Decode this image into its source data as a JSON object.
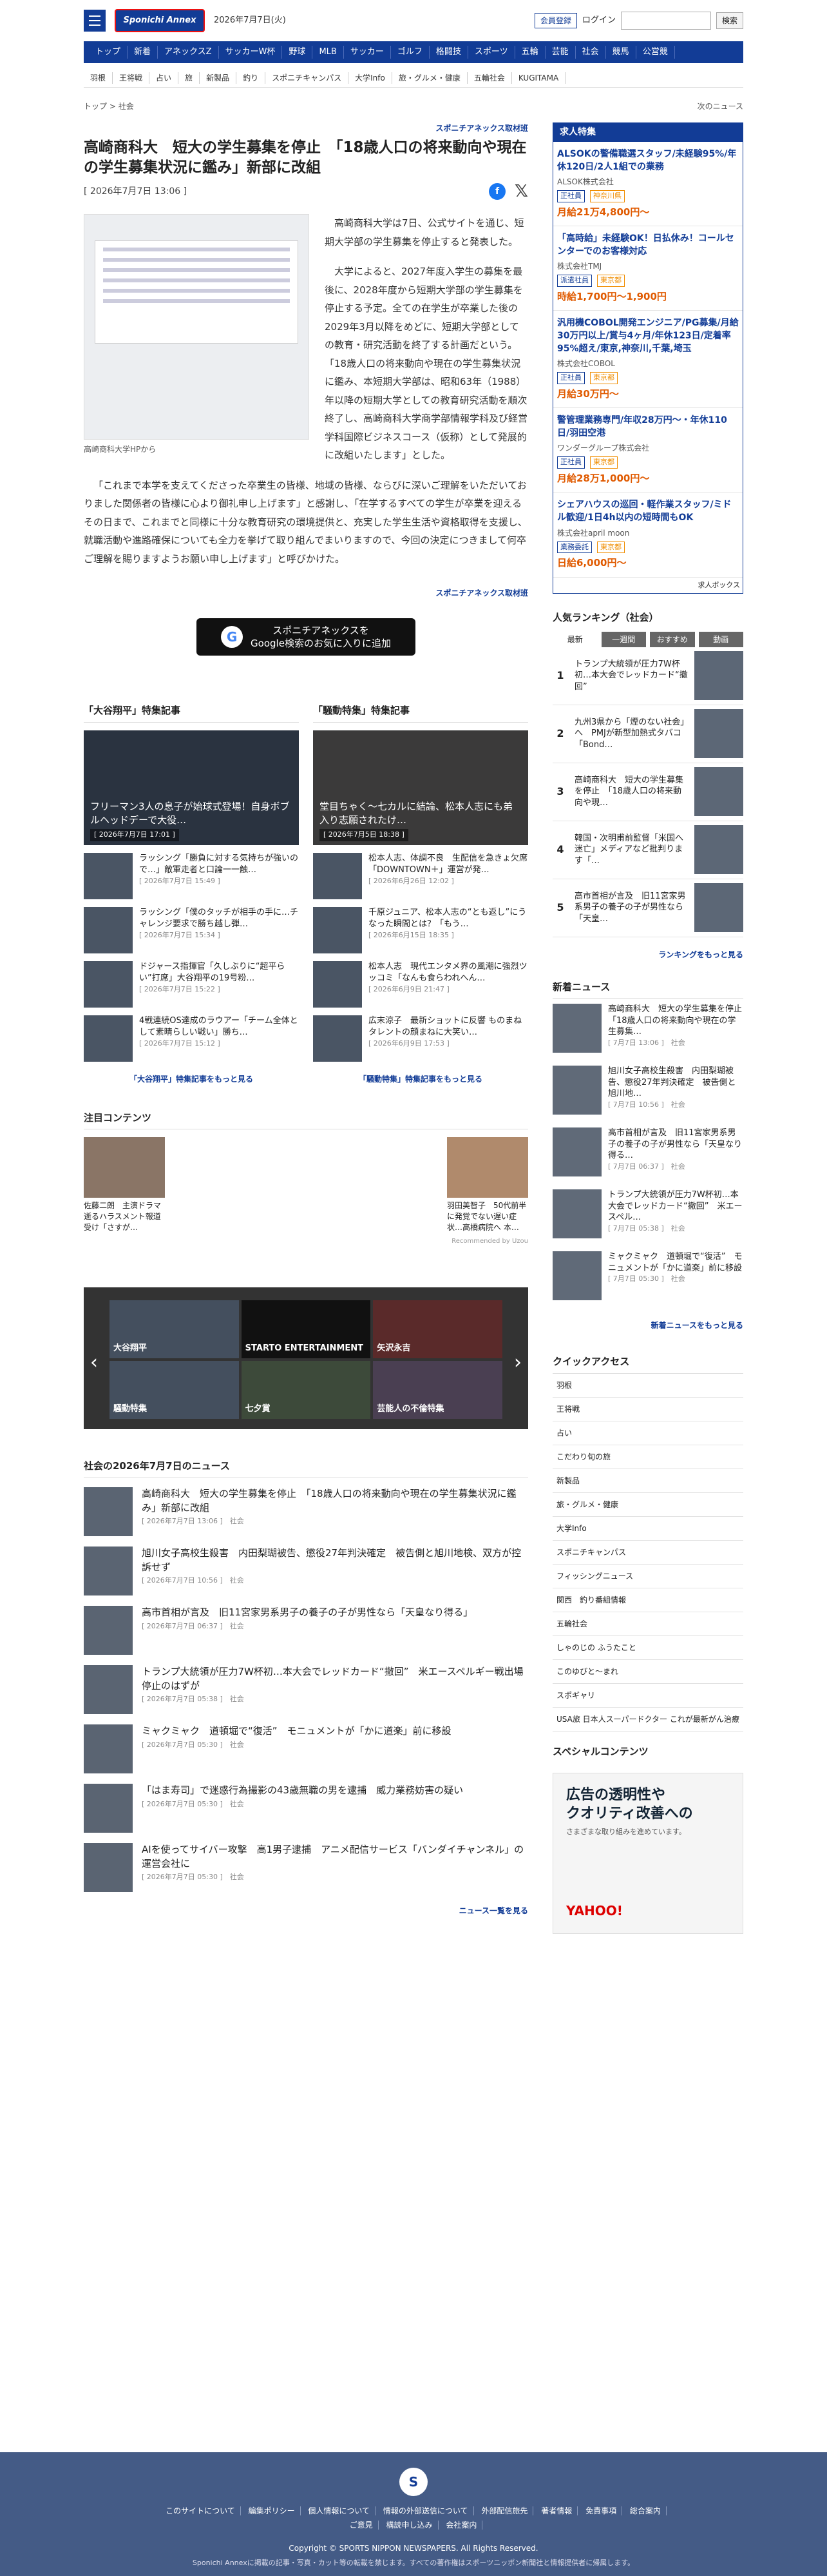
{
  "header": {
    "site_logo": "Sponichi Annex",
    "date": "2026年7月7日(火)",
    "member_register": "会員登録",
    "login": "ログイン",
    "search_button": "検索"
  },
  "nav": [
    "トップ",
    "新着",
    "アネックスZ",
    "サッカーW杯",
    "野球",
    "MLB",
    "サッカー",
    "ゴルフ",
    "格闘技",
    "スポーツ",
    "五輪",
    "芸能",
    "社会",
    "競馬",
    "公営競"
  ],
  "subnav": [
    "羽根",
    "王将戦",
    "占い",
    "旅",
    "新製品",
    "釣り",
    "スポニチキャンパス",
    "大学Info",
    "旅・グルメ・健康",
    "五輪社会",
    "KUGITAMA"
  ],
  "breadcrumb": {
    "top": "トップ",
    "sep": ">",
    "current": "社会",
    "next": "次のニュース"
  },
  "article": {
    "sponsor": "スポニチアネックス取材班",
    "title": "高崎商科大　短大の学生募集を停止　「18歳人口の将来動向や現在の学生募集状況に鑑み」新部に改組",
    "date": "[ 2026年7月7日 13:06 ]",
    "caption": "高崎商科大学HPから",
    "p1": "高崎商科大学は7日、公式サイトを通じ、短期大学部の学生募集を停止すると発表した。",
    "p2": "大学によると、2027年度入学生の募集を最後に、2028年度から短期大学部の学生募集を停止する予定。全ての在学生が卒業した後の2029年3月以降をめどに、短期大学部としての教育・研究活動を終了する計画だという。「18歳人口の将来動向や現在の学生募集状況に鑑み、本短期大学部は、昭和63年（1988）年以降の短期大学としての教育研究活動を順次終了し、高崎商科大学商学部情報学科及び経営学科国際ビジネスコース（仮称）として発展的に改組いたします」とした。",
    "p3": "「これまで本学を支えてくださった卒業生の皆様、地域の皆様、ならびに深いご理解をいただいておりました関係者の皆様に心より御礼申し上げます」と感謝し、「在学するすべての学生が卒業を迎えるその日まで、これまでと同様に十分な教育研究の環境提供と、充実した学生生活や資格取得を支援し、就職活動や進路確保についても全力を挙げて取り組んでまいりますので、今回の決定につきまして何卒ご理解を賜りますようお願い申し上げます」と呼びかけた。",
    "sponsor_bottom": "スポニチアネックス取材班",
    "google_line1": "スポニチアネックスを",
    "google_line2": "Google検索のお気に入りに追加"
  },
  "features": {
    "left_title": "「大谷翔平」特集記事",
    "left_hero": "フリーマン3人の息子が始球式登場！自身ボブルヘッドデーで大役…",
    "left_hero_date": "[ 2026年7月7日 17:01 ]",
    "left_items": [
      {
        "t": "ラッシング「勝負に対する気持ちが強いので…」敵軍走者と口論一一触…",
        "d": "[ 2026年7月7日 15:49 ]"
      },
      {
        "t": "ラッシング「僕のタッチが相手の手に…チャレンジ要求で勝ち越し弾…",
        "d": "[ 2026年7月7日 15:34 ]"
      },
      {
        "t": "ドジャース指揮官「久しぶりに“超平らい”打席」大谷翔平の19号粉…",
        "d": "[ 2026年7月7日 15:22 ]"
      },
      {
        "t": "4戦連続OS達成のラウアー「チーム全体として素晴らしい戦い」勝ち…",
        "d": "[ 2026年7月7日 15:12 ]"
      }
    ],
    "left_more": "「大谷翔平」特集記事をもっと見る",
    "right_title": "「騒動特集」特集記事",
    "right_hero": "堂目ちゃく～七カルに結論、松本人志にも弟入り志願されたけ…",
    "right_hero_date": "[ 2026年7月5日 18:38 ]",
    "right_items": [
      {
        "t": "松本人志、体調不良　生配信を急きょ欠席「DOWNTOWN＋」運営が発…",
        "d": "[ 2026年6月26日 12:02 ]"
      },
      {
        "t": "千原ジュニア、松本人志の“とも返し”にうなった瞬間とは？「もう…",
        "d": "[ 2026年6月15日 18:35 ]"
      },
      {
        "t": "松本人志　現代エンタメ界の風潮に強烈ツッコミ「なんも食らわれへん…",
        "d": "[ 2026年6月9日 21:47 ]"
      },
      {
        "t": "広末涼子　最新ショットに反響 ものまねタレントの顔まねに大笑い…",
        "d": "[ 2026年6月9日 17:53 ]"
      }
    ],
    "right_more": "「騒動特集」特集記事をもっと見る"
  },
  "attention": {
    "title": "注目コンテンツ",
    "left_text": "佐藤二朗　主演ドラマ逝るハラスメント報道受け「さすが…",
    "right_text": "羽田美智子　50代前半に発覚でない遅い症状…高橋病院へ 本…",
    "recommend": "Recommended by Uzou"
  },
  "banner_tiles": [
    "大谷翔平",
    "STARTO ENTERTAINMENT",
    "矢沢永吉",
    "騒動特集",
    "七夕賞",
    "芸能人の不倫特集"
  ],
  "social_news": {
    "title": "社会の2026年7月7日のニュース",
    "items": [
      {
        "t": "高崎商科大　短大の学生募集を停止　「18歳人口の将来動向や現在の学生募集状況に鑑み」新部に改組",
        "d": "[ 2026年7月7日 13:06 ]　社会"
      },
      {
        "t": "旭川女子高校生殺害　内田梨瑚被告、懲役27年判決確定　被告側と旭川地検、双方が控訴せず",
        "d": "[ 2026年7月7日 10:56 ]　社会"
      },
      {
        "t": "高市首相が言及　旧11宮家男系男子の養子の子が男性なら「天皇なり得る」",
        "d": "[ 2026年7月7日 06:37 ]　社会"
      },
      {
        "t": "トランプ大統領が圧力7W杯初…本大会でレッドカード“撤回”　米エースペルギー戦出場停止のはずが",
        "d": "[ 2026年7月7日 05:38 ]　社会"
      },
      {
        "t": "ミャクミャク　道頓堀で“復活”　モニュメントが「かに道楽」前に移設",
        "d": "[ 2026年7月7日 05:30 ]　社会"
      },
      {
        "t": "「はま寿司」で迷惑行為撮影の43歳無職の男を逮捕　威力業務妨害の疑い",
        "d": "[ 2026年7月7日 05:30 ]　社会"
      },
      {
        "t": "AIを使ってサイバー攻撃　高1男子逮捕　アニメ配信サービス「バンダイチャンネル」の運営会社に",
        "d": "[ 2026年7月7日 05:30 ]　社会"
      }
    ],
    "more": "ニュース一覧を見る"
  },
  "jobs": {
    "title": "求人特集",
    "items": [
      {
        "t": "ALSOKの警備職選スタッフ/未経験95%/年休120日/2人1組での業務",
        "c": "ALSOK株式会社",
        "tags": [
          "正社員",
          "神奈川県"
        ],
        "s": "月給21万4,800円～"
      },
      {
        "t": "「高時給」未経験OK！日払休み！コールセンターでのお客様対応",
        "c": "株式会社TMJ",
        "tags": [
          "派遣社員",
          "東京都"
        ],
        "s": "時給1,700円～1,900円"
      },
      {
        "t": "汎用機COBOL開発エンジニア/PG募集/月給30万円以上/賞与4ヶ月/年休123日/定着率95%超え/東京,神奈川,千葉,埼玉",
        "c": "株式会社COBOL",
        "tags": [
          "正社員",
          "東京都"
        ],
        "s": "月給30万円～"
      },
      {
        "t": "警管理業務専門/年収28万円～・年休110日/羽田空港",
        "c": "ワンダーグループ株式会社",
        "tags": [
          "正社員",
          "東京都"
        ],
        "s": "月給28万1,000円～"
      },
      {
        "t": "シェアハウスの巡回・軽作業スタッフ/ミドル歓迎/1日4h以内の短時間もOK",
        "c": "株式会社april moon",
        "tags": [
          "業務委託",
          "東京都"
        ],
        "s": "日給6,000円～"
      }
    ],
    "footer": "求人ボックス"
  },
  "ranking": {
    "title": "人気ランキング（社会）",
    "tabs": [
      "最新",
      "一週間",
      "おすすめ",
      "動画"
    ],
    "items": [
      {
        "n": "1",
        "t": "トランプ大統領が圧力7W杯初…本大会でレッドカード“撤回”"
      },
      {
        "n": "2",
        "t": "九州3県から「煙のない社会」へ　PMJが新型加熱式タバコ「Bond…"
      },
      {
        "n": "3",
        "t": "高崎商科大　短大の学生募集を停止　「18歳人口の将来動向や現…"
      },
      {
        "n": "4",
        "t": "韓国・次明甫前監督「米国へ迷亡」メディアなど批判ります「…"
      },
      {
        "n": "5",
        "t": "高市首相が言及　旧11宮家男系男子の養子の子が男性なら「天皇…"
      }
    ],
    "more": "ランキングをもっと見る"
  },
  "side_news": {
    "title": "新着ニュース",
    "items": [
      {
        "t": "高崎商科大　短大の学生募集を停止　「18歳人口の将来動向や現在の学生募集…",
        "d": "[ 7月7日 13:06 ]　社会"
      },
      {
        "t": "旭川女子高校生殺害　内田梨瑚被告、懲役27年判決確定　被告側と旭川地…",
        "d": "[ 7月7日 10:56 ]　社会"
      },
      {
        "t": "高市首相が言及　旧11宮家男系男子の養子の子が男性なら「天皇なり得る…",
        "d": "[ 7月7日 06:37 ]　社会"
      },
      {
        "t": "トランプ大統領が圧力7W杯初…本大会でレッドカード“撤回”　米エースペル…",
        "d": "[ 7月7日 05:38 ]　社会"
      },
      {
        "t": "ミャクミャク　道頓堀で“復活”　モニュメントが「かに道楽」前に移設",
        "d": "[ 7月7日 05:30 ]　社会"
      }
    ],
    "more": "新着ニュースをもっと見る"
  },
  "quick": {
    "title": "クイックアクセス",
    "items": [
      "羽根",
      "王将戦",
      "占い",
      "こだわり旬の旅",
      "新製品",
      "旅・グルメ・健康",
      "大学Info",
      "スポニチキャンパス",
      "フィッシングニュース",
      "関西　釣り番組情報",
      "五輪社会",
      "しゃのじの ふうたこと",
      "このゆびと～まれ",
      "スポギャリ",
      "USA旅 日本人スーパードクター これが最新がん治療"
    ]
  },
  "special": {
    "title": "スペシャルコンテンツ",
    "ad_line1": "広告の透明性や",
    "ad_line2": "クオリティ改善への",
    "ad_sub": "さまざまな取り組みを進めています。",
    "ad_brand": "YAHOO!"
  },
  "footer": {
    "logo": "S",
    "links": [
      "このサイトについて",
      "編集ポリシー",
      "個人情報について",
      "情報の外部送信について",
      "外部配信旅先",
      "著者情報",
      "免責事項",
      "総合案内",
      "ご意見",
      "構読申し込み",
      "会社案内"
    ],
    "copyright": "Copyright © SPORTS NIPPON NEWSPAPERS. All Rights Reserved.",
    "note": "Sponichi Annexに掲載の記事・写真・カット等の転載を禁じます。すべての著作権はスポーツニッポン新聞社と情報提供者に帰属します。"
  }
}
